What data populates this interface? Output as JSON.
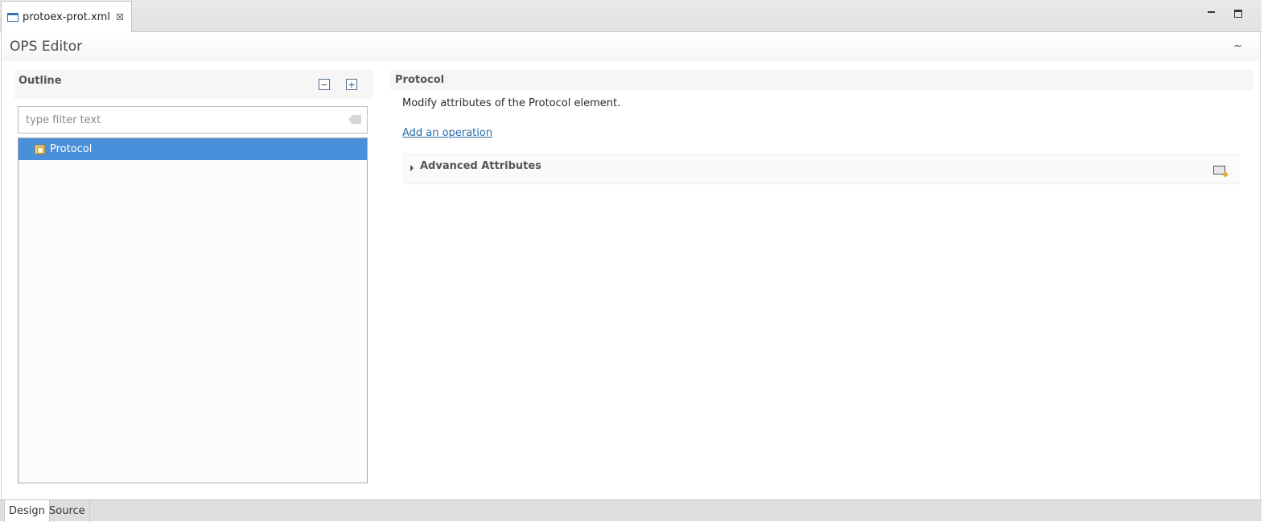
{
  "editor_tab": {
    "label": "protoex-prot.xml",
    "close_glyph": "☒"
  },
  "window_controls": {
    "minimize_icon": "minimize-icon",
    "maximize_icon": "maximize-icon"
  },
  "form": {
    "title": "OPS Editor",
    "collapse_glyph": "~"
  },
  "outline": {
    "title": "Outline",
    "collapse_all_glyph": "−",
    "expand_all_glyph": "+",
    "filter_placeholder": "type filter text",
    "filter_value": "",
    "tree_items": [
      {
        "label": "Protocol",
        "selected": true,
        "icon": "element-folder-icon"
      }
    ]
  },
  "details": {
    "title": "Protocol",
    "description": "Modify attributes of the Protocol element.",
    "link_label": "Add an operation",
    "advanced_label": "Advanced Attributes"
  },
  "page_tabs": [
    {
      "label": "Design",
      "active": true
    },
    {
      "label": "Source",
      "active": false
    }
  ],
  "colors": {
    "selection": "#4a8fd9",
    "link": "#2a6aa8"
  }
}
